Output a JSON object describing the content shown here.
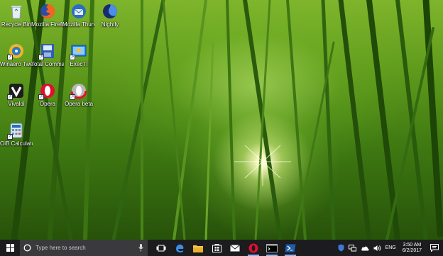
{
  "desktop": {
    "icons": [
      {
        "label": "Recycle Bin",
        "icon": "recycle-bin-icon"
      },
      {
        "label": "Mozilla Firefox",
        "icon": "firefox-icon"
      },
      {
        "label": "Mozilla Thunderbird",
        "icon": "thunderbird-icon"
      },
      {
        "label": "Nightly",
        "icon": "nightly-icon"
      },
      {
        "label": "Winaero Tweaker",
        "icon": "winaero-tweaker-icon"
      },
      {
        "label": "Total Command...",
        "icon": "total-commander-icon"
      },
      {
        "label": "ExecTI",
        "icon": "execti-icon"
      },
      {
        "label": "Vivaldi",
        "icon": "vivaldi-icon"
      },
      {
        "label": "Opera",
        "icon": "opera-icon"
      },
      {
        "label": "Opera beta",
        "icon": "opera-beta-icon"
      },
      {
        "label": "OiB Calculator f...",
        "icon": "calculator-icon"
      }
    ]
  },
  "taskbar": {
    "search_placeholder": "Type here to search",
    "apps": [
      "task-view-icon",
      "edge-icon",
      "file-explorer-icon",
      "store-icon",
      "mail-icon",
      "opera-icon",
      "command-prompt-icon",
      "powershell-icon"
    ],
    "tray": {
      "language": "ENG",
      "time": "3:50 AM",
      "date": "6/2/2017"
    }
  },
  "colors": {
    "taskbar_bg": "#1c1c1f",
    "search_bg": "#3a3a3d",
    "accent": "#0078d7"
  }
}
